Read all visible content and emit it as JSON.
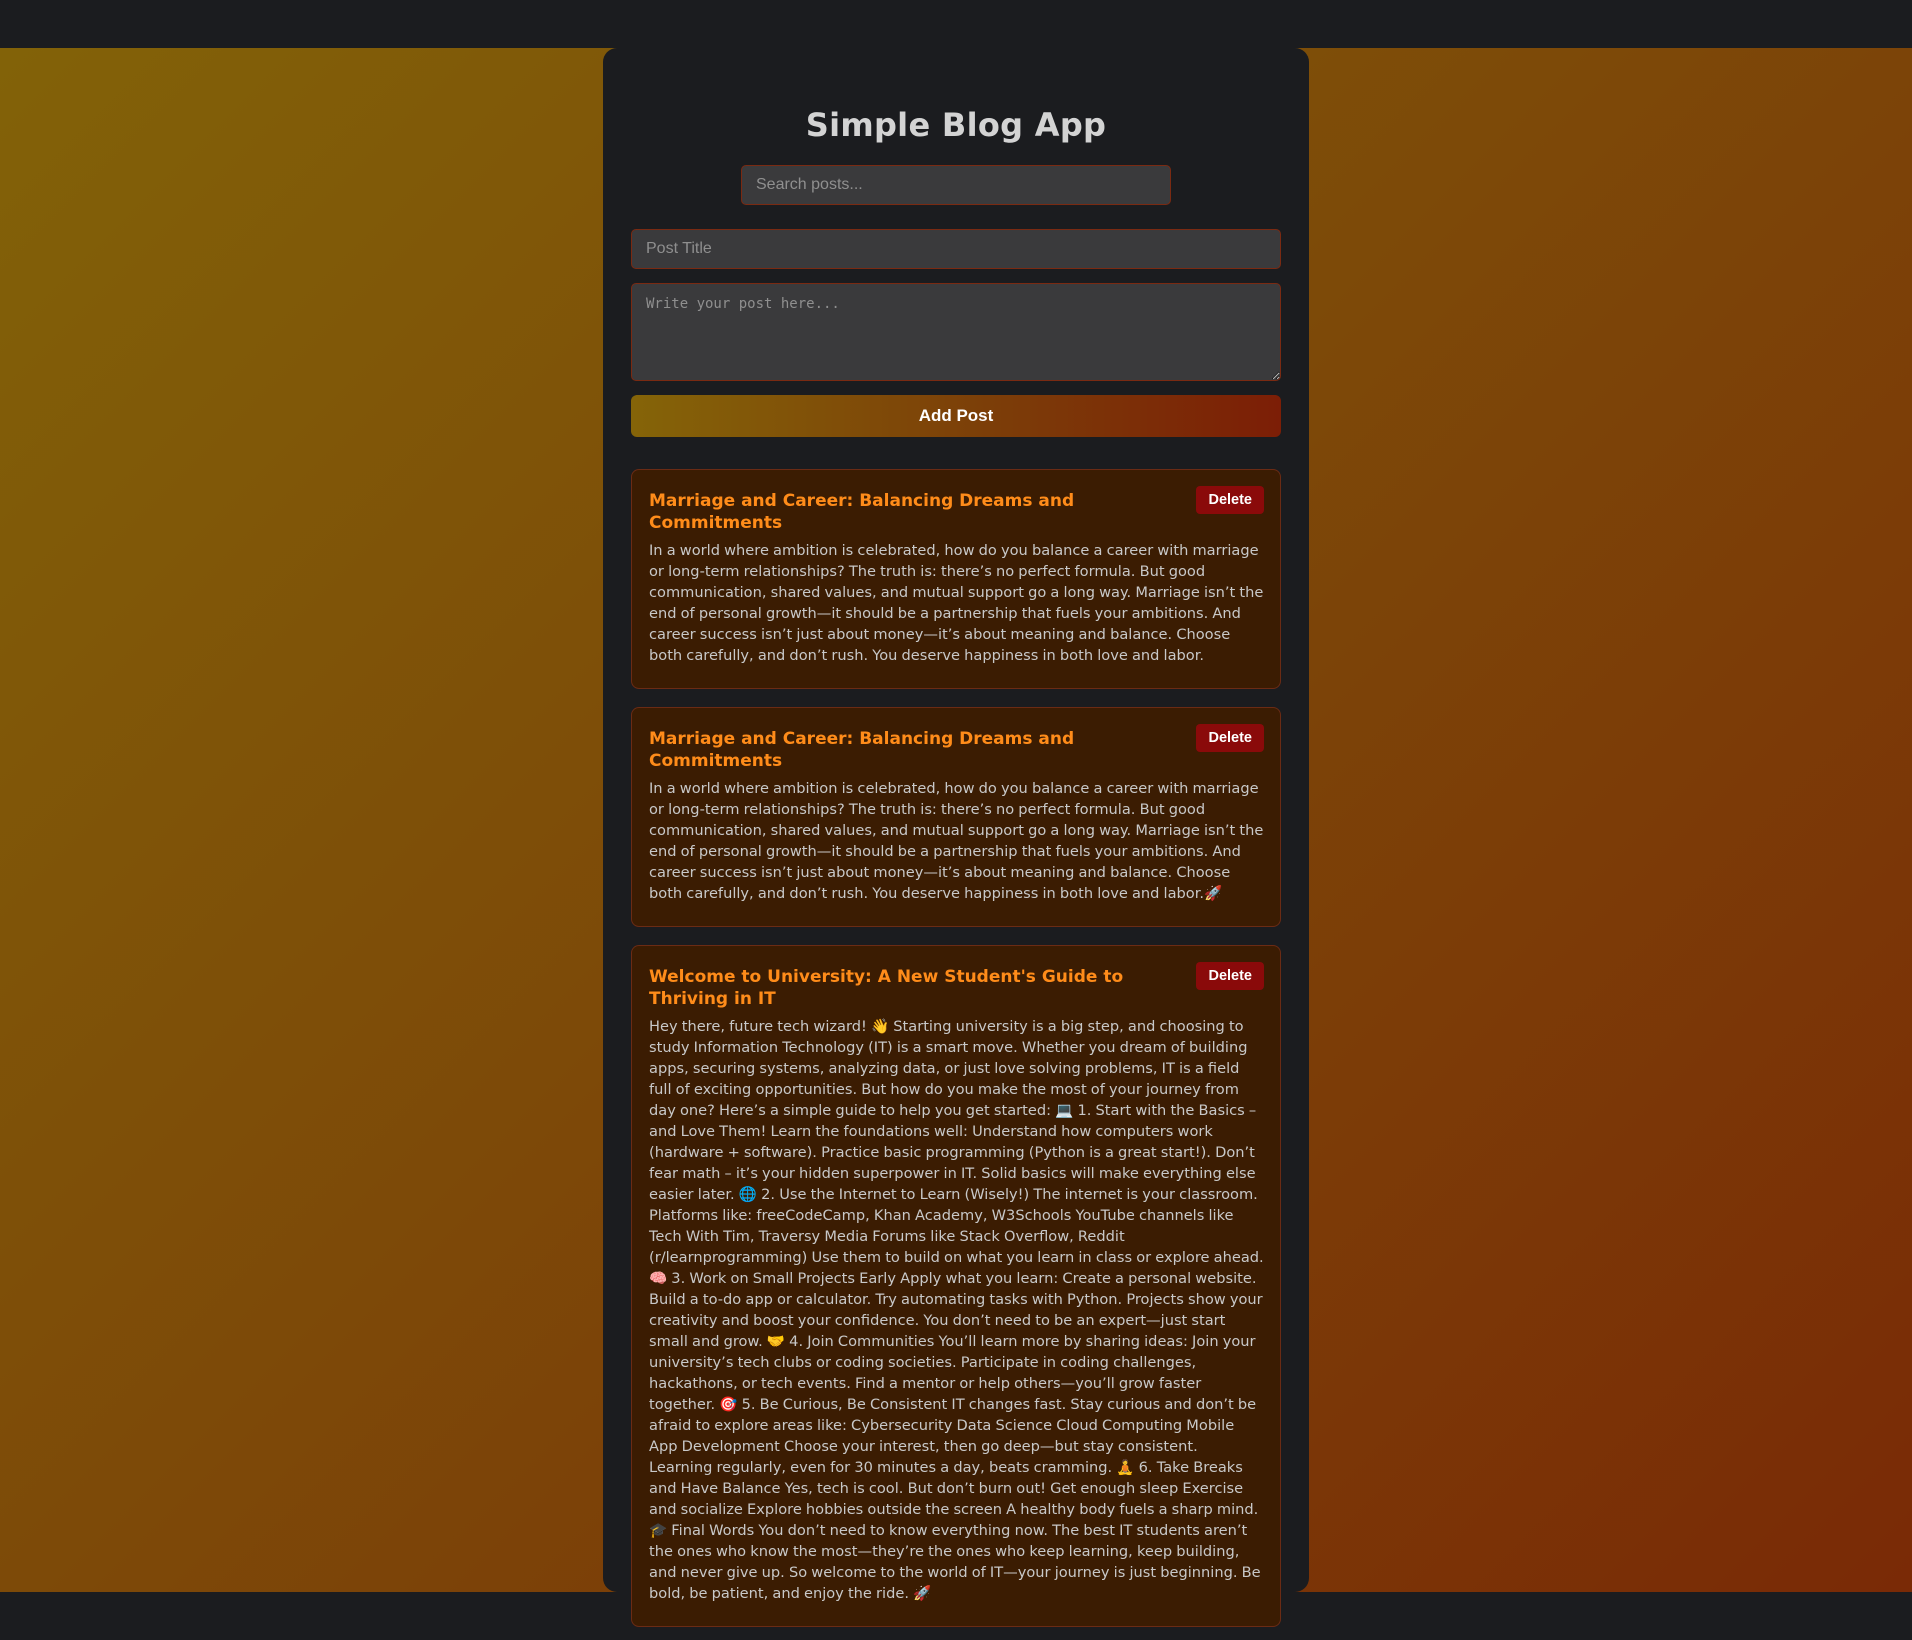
{
  "app": {
    "title": "Simple Blog App"
  },
  "search": {
    "placeholder": "Search posts..."
  },
  "form": {
    "title_placeholder": "Post Title",
    "body_placeholder": "Write your post here...",
    "add_label": "Add Post"
  },
  "posts": [
    {
      "title": "Marriage and Career: Balancing Dreams and Commitments",
      "delete_label": "Delete",
      "body": "In a world where ambition is celebrated, how do you balance a career with marriage or long-term relationships? The truth is: there’s no perfect formula. But good communication, shared values, and mutual support go a long way. Marriage isn’t the end of personal growth—it should be a partnership that fuels your ambitions. And career success isn’t just about money—it’s about meaning and balance. Choose both carefully, and don’t rush. You deserve happiness in both love and labor."
    },
    {
      "title": "Marriage and Career: Balancing Dreams and Commitments",
      "delete_label": "Delete",
      "body": "In a world where ambition is celebrated, how do you balance a career with marriage or long-term relationships? The truth is: there’s no perfect formula. But good communication, shared values, and mutual support go a long way. Marriage isn’t the end of personal growth—it should be a partnership that fuels your ambitions. And career success isn’t just about money—it’s about meaning and balance. Choose both carefully, and don’t rush. You deserve happiness in both love and labor.🚀"
    },
    {
      "title": "Welcome to University: A New Student's Guide to Thriving in IT",
      "delete_label": "Delete",
      "body": "Hey there, future tech wizard! 👋 Starting university is a big step, and choosing to study Information Technology (IT) is a smart move. Whether you dream of building apps, securing systems, analyzing data, or just love solving problems, IT is a field full of exciting opportunities. But how do you make the most of your journey from day one? Here’s a simple guide to help you get started: 💻 1. Start with the Basics – and Love Them! Learn the foundations well: Understand how computers work (hardware + software). Practice basic programming (Python is a great start!). Don’t fear math – it’s your hidden superpower in IT. Solid basics will make everything else easier later. 🌐 2. Use the Internet to Learn (Wisely!) The internet is your classroom. Platforms like: freeCodeCamp, Khan Academy, W3Schools YouTube channels like Tech With Tim, Traversy Media Forums like Stack Overflow, Reddit (r/learnprogramming) Use them to build on what you learn in class or explore ahead. 🧠 3. Work on Small Projects Early Apply what you learn: Create a personal website. Build a to-do app or calculator. Try automating tasks with Python. Projects show your creativity and boost your confidence. You don’t need to be an expert—just start small and grow. 🤝 4. Join Communities You’ll learn more by sharing ideas: Join your university’s tech clubs or coding societies. Participate in coding challenges, hackathons, or tech events. Find a mentor or help others—you’ll grow faster together. 🎯 5. Be Curious, Be Consistent IT changes fast. Stay curious and don’t be afraid to explore areas like: Cybersecurity Data Science Cloud Computing Mobile App Development Choose your interest, then go deep—but stay consistent. Learning regularly, even for 30 minutes a day, beats cramming. 🧘 6. Take Breaks and Have Balance Yes, tech is cool. But don’t burn out! Get enough sleep Exercise and socialize Explore hobbies outside the screen A healthy body fuels a sharp mind. 🎓 Final Words You don’t need to know everything now. The best IT students aren’t the ones who know the most—they’re the ones who keep learning, keep building, and never give up. So welcome to the world of IT—your journey is just beginning. Be bold, be patient, and enjoy the ride. 🚀"
    }
  ],
  "colors": {
    "accent_title": "#ff8c1a",
    "delete": "#8a0a0a",
    "post_bg": "#3b1c02",
    "panel_bg": "#1b1c1f"
  }
}
